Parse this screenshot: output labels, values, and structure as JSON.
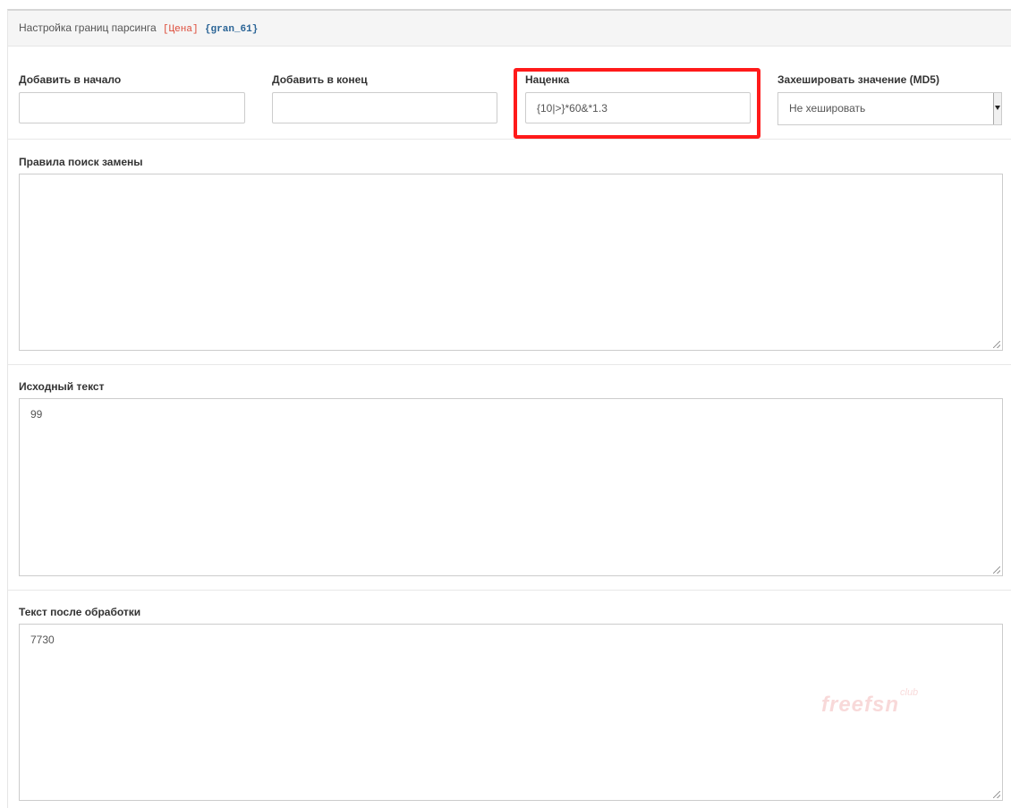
{
  "panel": {
    "title": "Настройка границ парсинга",
    "tag_field": "[Цена]",
    "tag_id": "{gran_61}"
  },
  "fields": {
    "prepend": {
      "label": "Добавить в начало",
      "value": ""
    },
    "append": {
      "label": "Добавить в конец",
      "value": ""
    },
    "markup": {
      "label": "Наценка",
      "value": "{10|>}*60&*1.3"
    },
    "hash": {
      "label": "Захешировать значение (MD5)",
      "selected": "Не хешировать"
    }
  },
  "replace_rules": {
    "label": "Правила поиск замены",
    "value": ""
  },
  "source_text": {
    "label": "Исходный текст",
    "value": "99"
  },
  "result_text": {
    "label": "Текст после обработки",
    "value": "7730"
  },
  "watermark": {
    "text": "freefsn",
    "sub": "club"
  },
  "colors": {
    "highlight": "#ff1a1a",
    "tag_field": "#dd4b39",
    "tag_id": "#2a6496"
  }
}
